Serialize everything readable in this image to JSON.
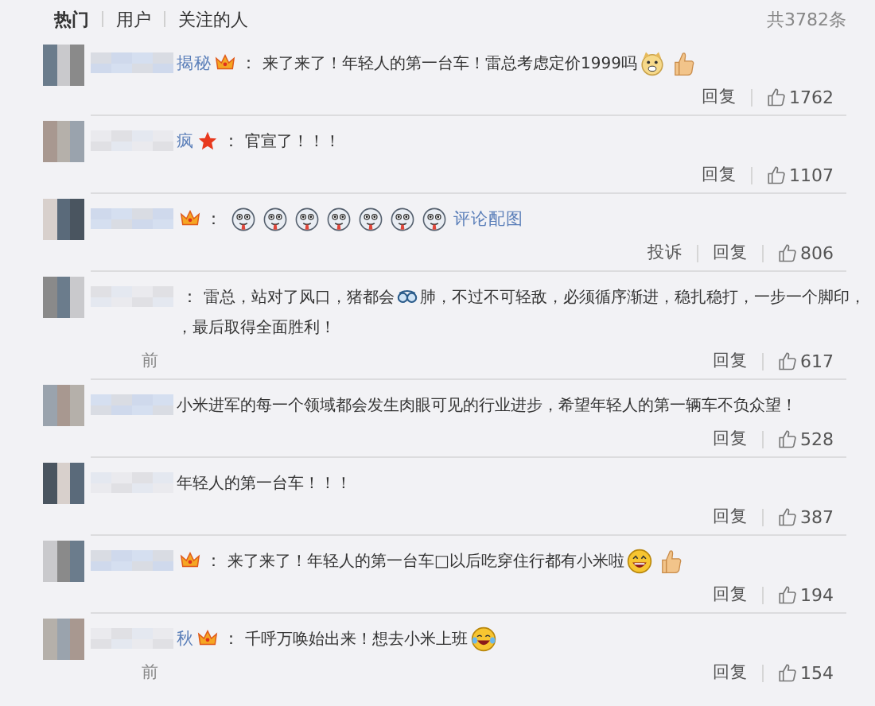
{
  "tabs": [
    {
      "label": "热门",
      "selected": true
    },
    {
      "label": "用户",
      "selected": false
    },
    {
      "label": "关注的人",
      "selected": false
    }
  ],
  "total": "共3782条",
  "comments": [
    {
      "name": "揭秘",
      "badge": {
        "kind": "crown"
      },
      "separator": "：",
      "lines": [
        [
          {
            "kind": "text",
            "text": "来了来了！年轻人的第一台车！雷总考虑定价1999吗"
          },
          {
            "kind": "doge"
          },
          {
            "kind": "thumb"
          }
        ]
      ],
      "actions": [
        "回复"
      ],
      "likes": "1762"
    },
    {
      "name": "疯",
      "badge": {
        "kind": "star"
      },
      "separator": "：",
      "lines": [
        [
          {
            "kind": "text",
            "text": "官宣了！！！"
          }
        ]
      ],
      "actions": [
        "回复"
      ],
      "likes": "1107"
    },
    {
      "badge": {
        "kind": "crown"
      },
      "separator": "：",
      "lines": [
        [
          {
            "kind": "tongue"
          },
          {
            "kind": "tongue"
          },
          {
            "kind": "tongue"
          },
          {
            "kind": "tongue"
          },
          {
            "kind": "tongue"
          },
          {
            "kind": "tongue"
          },
          {
            "kind": "tongue"
          },
          {
            "kind": "link",
            "text": "评论配图"
          }
        ]
      ],
      "actions": [
        "投诉",
        "回复"
      ],
      "likes": "806"
    },
    {
      "separator": "：",
      "lines": [
        [
          {
            "kind": "text",
            "text": "雷总，站对了风口，猪都会"
          },
          {
            "kind": "goggles"
          },
          {
            "kind": "text",
            "text": "肺，不过不可轻敌，必须循序渐进，稳扎稳打，一步一个脚印，"
          }
        ],
        [
          {
            "kind": "text",
            "text": "，最后取得全面胜利！"
          }
        ]
      ],
      "time": "前",
      "actions": [
        "回复"
      ],
      "likes": "617"
    },
    {
      "lines": [
        [
          {
            "kind": "text",
            "text": "小米进军的每一个领域都会发生肉眼可见的行业进步，希望年轻人的第一辆车不负众望！"
          }
        ]
      ],
      "actions": [
        "回复"
      ],
      "likes": "528"
    },
    {
      "lines": [
        [
          {
            "kind": "text",
            "text": "年轻人的第一台车！！！"
          }
        ]
      ],
      "actions": [
        "回复"
      ],
      "likes": "387"
    },
    {
      "badge": {
        "kind": "crown"
      },
      "separator": "：",
      "lines": [
        [
          {
            "kind": "text",
            "text": "来了来了！年轻人的第一台车□以后吃穿住行都有小米啦"
          },
          {
            "kind": "grin"
          },
          {
            "kind": "thumb"
          }
        ]
      ],
      "actions": [
        "回复"
      ],
      "likes": "194"
    },
    {
      "name": "秋",
      "badge": {
        "kind": "crown"
      },
      "separator": "：",
      "lines": [
        [
          {
            "kind": "text",
            "text": "千呼万唤始出来！想去小米上班"
          },
          {
            "kind": "tears"
          }
        ]
      ],
      "time": "前",
      "actions": [
        "回复"
      ],
      "likes": "154"
    }
  ]
}
